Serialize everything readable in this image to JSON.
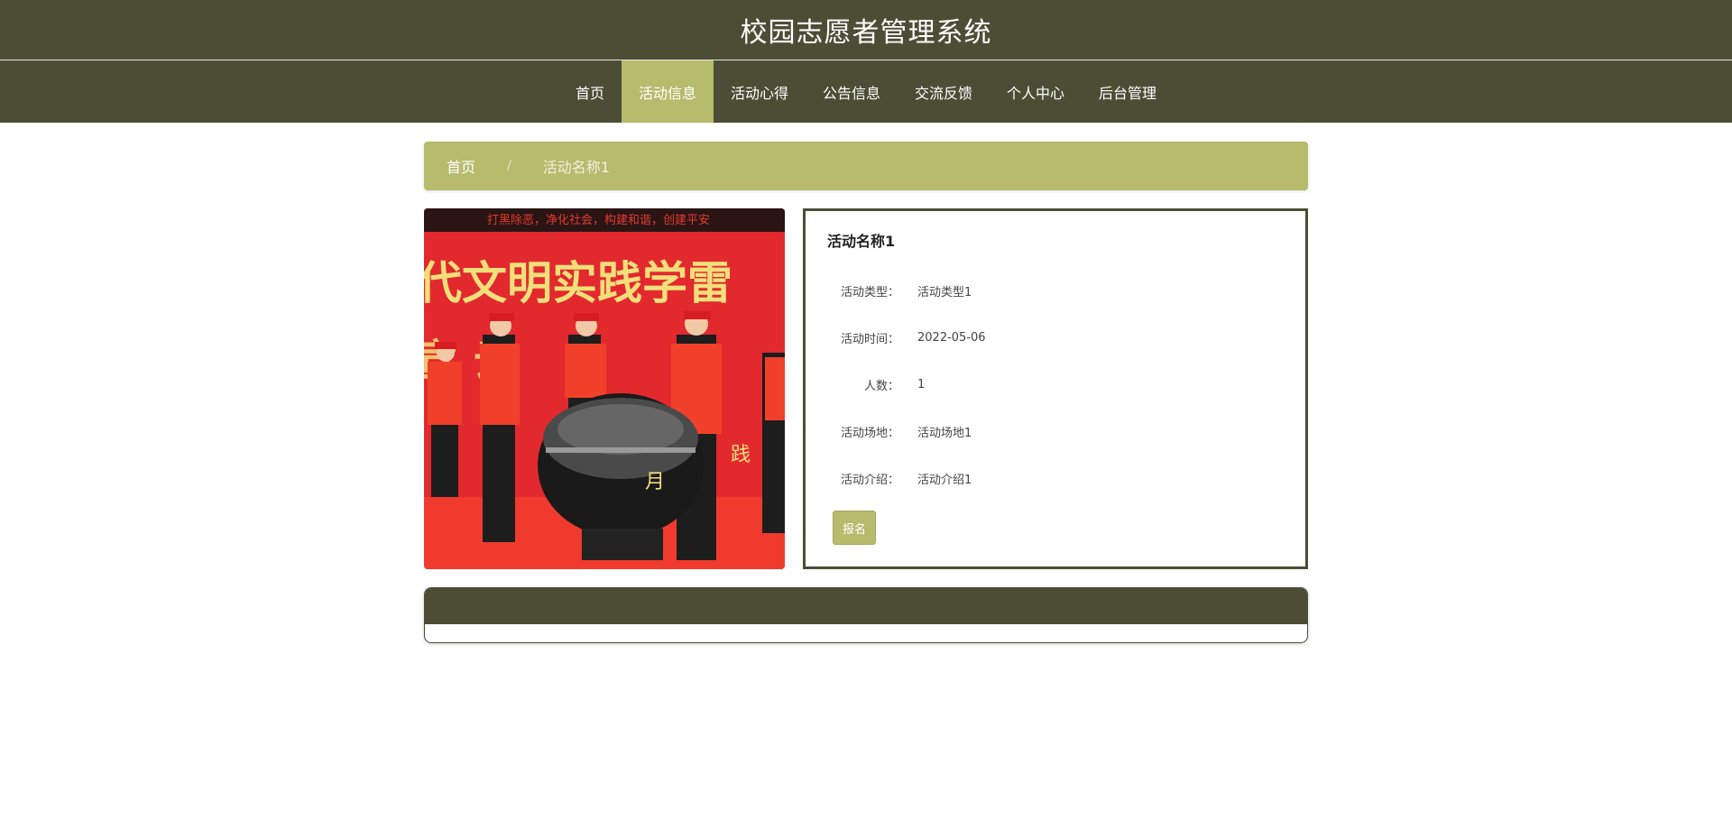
{
  "header": {
    "title": "校园志愿者管理系统"
  },
  "nav": {
    "items": [
      {
        "label": "首页"
      },
      {
        "label": "活动信息",
        "active": true
      },
      {
        "label": "活动心得"
      },
      {
        "label": "公告信息"
      },
      {
        "label": "交流反馈"
      },
      {
        "label": "个人中心"
      },
      {
        "label": "后台管理"
      }
    ]
  },
  "breadcrumb": {
    "home": "首页",
    "separator": "/",
    "current": "活动名称1"
  },
  "photo": {
    "banner_top": "打黑除恶，净化社会，构建和谐，创建平安",
    "banner_main": "代文明实践学雷",
    "icon": "activity-photo"
  },
  "detail": {
    "title": "活动名称1",
    "fields": [
      {
        "label": "活动类型：",
        "value": "活动类型1"
      },
      {
        "label": "活动时间：",
        "value": "2022-05-06"
      },
      {
        "label": "人数：",
        "value": "1"
      },
      {
        "label": "活动场地：",
        "value": "活动场地1"
      },
      {
        "label": "活动介绍：",
        "value": "活动介绍1"
      }
    ],
    "signup_label": "报名"
  },
  "colors": {
    "primary": "#4b4e35",
    "accent": "#b7bb6c"
  }
}
